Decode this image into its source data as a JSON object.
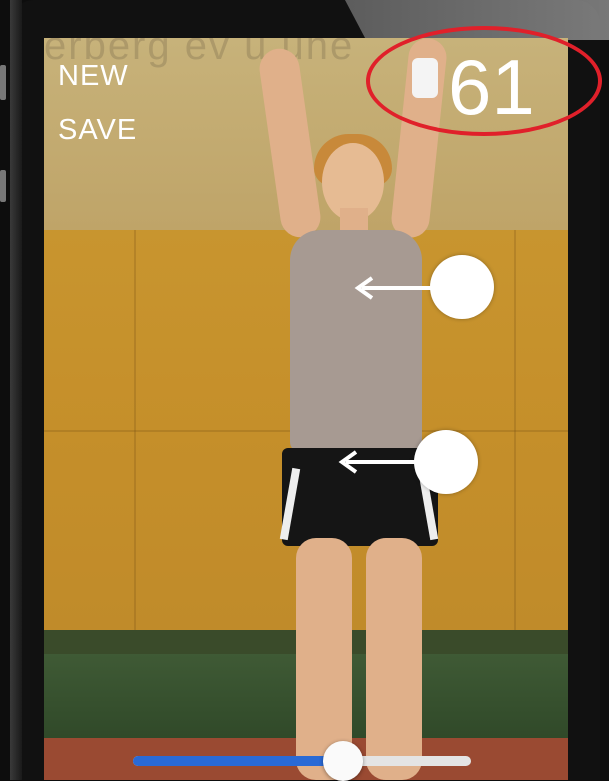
{
  "controls": {
    "new_label": "NEW",
    "save_label": "SAVE"
  },
  "counter": {
    "value": "61"
  },
  "highlight": {
    "color": "#e0202a"
  },
  "markers": [
    {
      "name": "upper-body-marker",
      "direction": "left"
    },
    {
      "name": "hip-marker",
      "direction": "left"
    }
  ],
  "slider": {
    "progress": 0.62,
    "fill_color": "#2a6ad6"
  },
  "icons": {
    "marker_arrow": "arrow-left-icon"
  }
}
